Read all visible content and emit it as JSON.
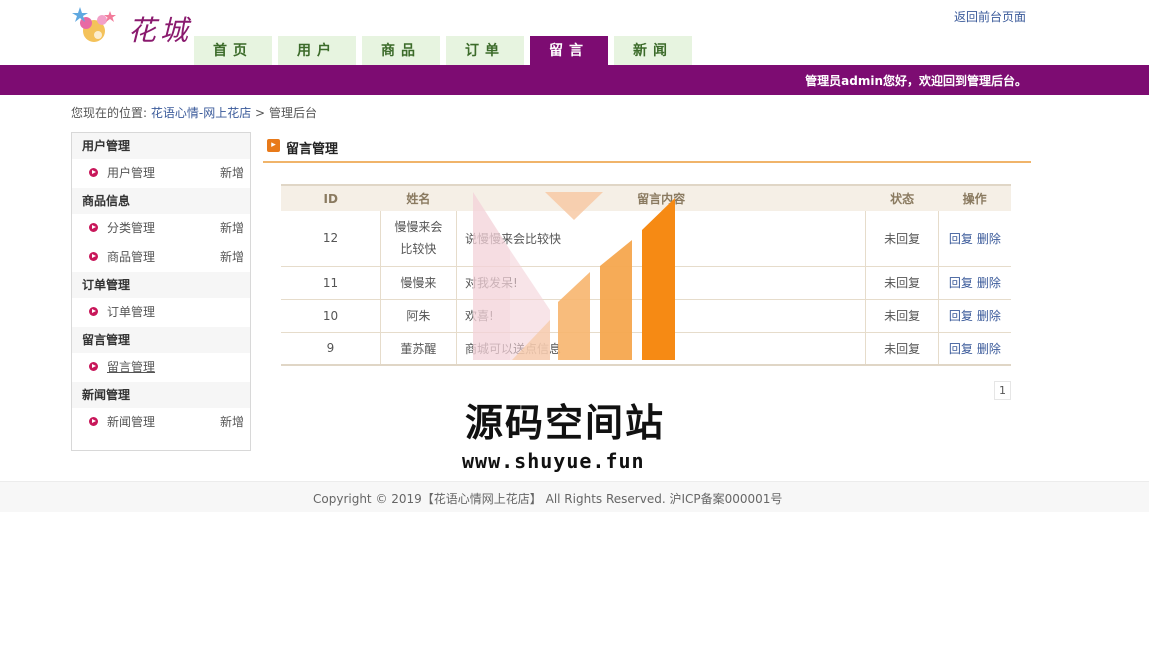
{
  "header": {
    "logo_text": "花城",
    "front_link": "返回前台页面",
    "nav": [
      "首页",
      "用户",
      "商品",
      "订单",
      "留言",
      "新闻"
    ],
    "active_nav": 4,
    "welcome": "管理员admin您好，欢迎回到管理后台。"
  },
  "breadcrumb": {
    "prefix": "您现在的位置:",
    "home": "花语心情-网上花店",
    "sep": ">",
    "current": "管理后台"
  },
  "sidebar": {
    "groups": [
      {
        "title": "用户管理",
        "items": [
          {
            "label": "用户管理",
            "add": "新增"
          }
        ]
      },
      {
        "title": "商品信息",
        "items": [
          {
            "label": "分类管理",
            "add": "新增"
          },
          {
            "label": "商品管理",
            "add": "新增"
          }
        ]
      },
      {
        "title": "订单管理",
        "items": [
          {
            "label": "订单管理",
            "add": ""
          }
        ]
      },
      {
        "title": "留言管理",
        "items": [
          {
            "label": "留言管理",
            "add": ""
          }
        ]
      },
      {
        "title": "新闻管理",
        "items": [
          {
            "label": "新闻管理",
            "add": "新增"
          }
        ]
      }
    ]
  },
  "content": {
    "title": "留言管理",
    "columns": [
      "ID",
      "姓名",
      "留言内容",
      "状态",
      "操作"
    ],
    "rows": [
      {
        "id": "12",
        "name": "慢慢来会比较快",
        "message": "说慢慢来会比较快",
        "status": "未回复",
        "reply": "回复",
        "delete": "删除"
      },
      {
        "id": "11",
        "name": "慢慢来",
        "message": "对我发呆!",
        "status": "未回复",
        "reply": "回复",
        "delete": "删除"
      },
      {
        "id": "10",
        "name": "阿朱",
        "message": "欢喜!",
        "status": "未回复",
        "reply": "回复",
        "delete": "删除"
      },
      {
        "id": "9",
        "name": "董苏醒",
        "message": "商城可以送点信息",
        "status": "未回复",
        "reply": "回复",
        "delete": "删除"
      }
    ],
    "page": "1"
  },
  "watermark": {
    "title": "源码空间站",
    "url": "www.shuyue.fun",
    "colors": [
      "#f3d2d8",
      "#f7c9a4",
      "#f6a64e",
      "#f68a14"
    ]
  },
  "footer": {
    "text": "Copyright © 2019【花语心情网上花店】 All Rights Reserved. 沪ICP备案000001号"
  }
}
